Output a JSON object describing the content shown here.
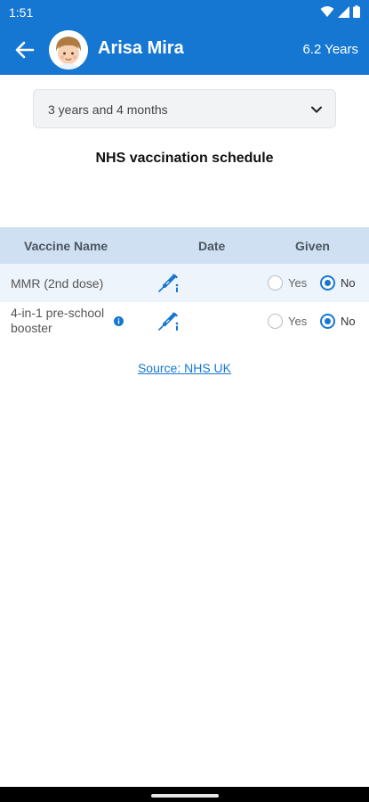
{
  "status_bar": {
    "time": "1:51",
    "icons": [
      "wifi-icon",
      "signal-icon",
      "battery-icon"
    ]
  },
  "app_bar": {
    "child_name": "Arisa Mira",
    "child_age": "6.2 Years",
    "back_icon": "arrow-left-icon",
    "color": "#1677d2"
  },
  "age_selector": {
    "selected": "3 years and 4 months"
  },
  "schedule": {
    "title": "NHS vaccination schedule",
    "columns": {
      "name": "Vaccine Name",
      "date": "Date",
      "given": "Given"
    },
    "rows": [
      {
        "name": "MMR (2nd dose)",
        "has_info": false,
        "yes_label": "Yes",
        "no_label": "No",
        "given": "No"
      },
      {
        "name": "4-in-1 pre-school booster",
        "has_info": true,
        "yes_label": "Yes",
        "no_label": "No",
        "given": "No"
      }
    ]
  },
  "source": {
    "label": "Source: NHS UK"
  }
}
